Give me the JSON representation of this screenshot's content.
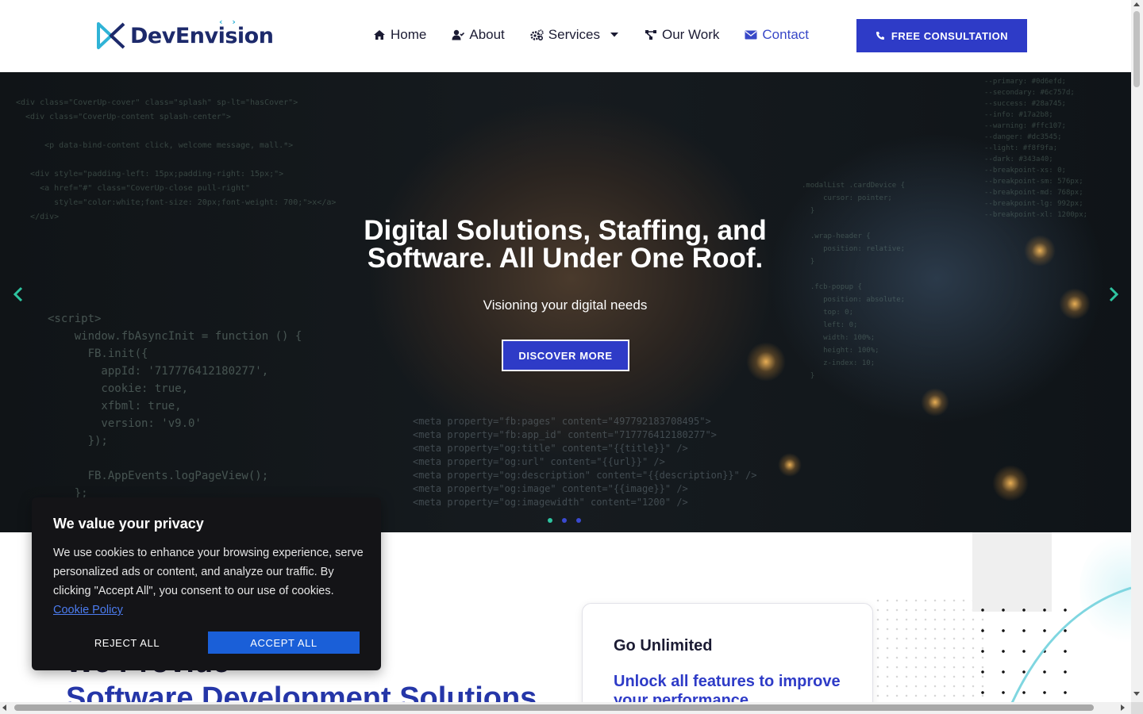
{
  "header": {
    "logo_text": "DevEnvision",
    "logo_brackets": "‹ ›",
    "nav": [
      {
        "label": "Home",
        "icon": "home-icon"
      },
      {
        "label": "About",
        "icon": "user-icon"
      },
      {
        "label": "Services",
        "icon": "cogs-icon",
        "dropdown": true
      },
      {
        "label": "Our Work",
        "icon": "network-icon"
      },
      {
        "label": "Contact",
        "icon": "envelope-icon",
        "active": true
      }
    ],
    "cta_label": "FREE CONSULTATION"
  },
  "hero": {
    "title_line1": "Digital Solutions, Staffing, and",
    "title_line2": "Software. All Under One Roof.",
    "subtitle": "Visioning your digital needs",
    "button_label": "DISCOVER MORE",
    "slide_count": 3,
    "active_slide": 1
  },
  "section": {
    "heading_line1": "We Provide",
    "heading_line2": "Software Development Solutions",
    "card_title": "Go Unlimited",
    "card_subtitle": "Unlock all features to improve your performance"
  },
  "cookie": {
    "title": "We value your privacy",
    "text": "We use cookies to enhance your browsing experience, serve personalized ads or content, and analyze our traffic. By clicking \"Accept All\", you consent to our use of cookies.",
    "link_text": "Cookie Policy",
    "reject_label": "REJECT ALL",
    "accept_label": "ACCEPT ALL"
  },
  "colors": {
    "brand_blue": "#2e3bc7",
    "accent_teal": "#2ec4a0",
    "nav_active": "#3848c7",
    "cookie_accept": "#1a5fd8"
  }
}
